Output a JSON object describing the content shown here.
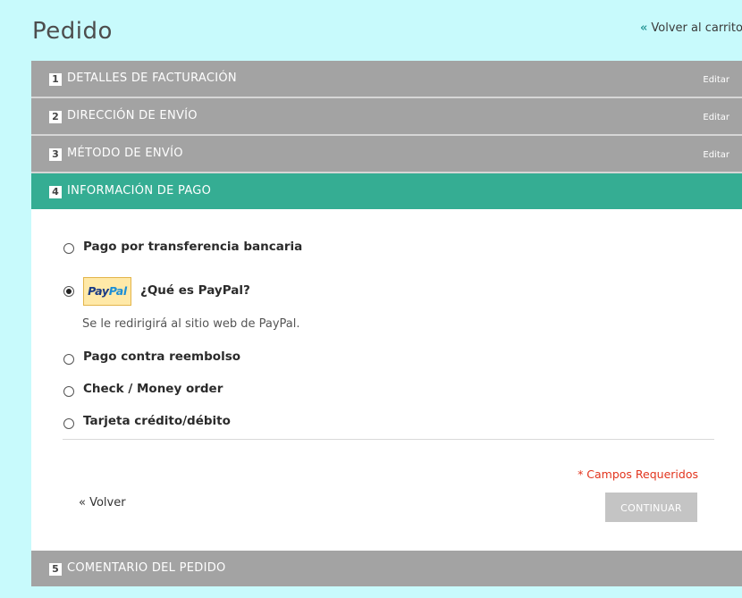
{
  "page": {
    "title": "Pedido",
    "back_to_cart": "Volver al carrito",
    "back_to_cart_prefix": "«"
  },
  "steps": [
    {
      "number": "1",
      "label": "DETALLES DE FACTURACIÓN",
      "edit": "Editar"
    },
    {
      "number": "2",
      "label": "DIRECCIÓN DE ENVÍO",
      "edit": "Editar"
    },
    {
      "number": "3",
      "label": "MÉTODO DE ENVÍO",
      "edit": "Editar"
    },
    {
      "number": "4",
      "label": "INFORMACIÓN DE PAGO"
    },
    {
      "number": "5",
      "label": "COMENTARIO DEL PEDIDO"
    }
  ],
  "payment": {
    "options": [
      {
        "label": "Pago por transferencia bancaria",
        "selected": false
      },
      {
        "label": "¿Qué es PayPal?",
        "selected": true,
        "logo_pay": "Pay",
        "logo_pal": "Pal",
        "note": "Se le redirigirá al sitio web de PayPal."
      },
      {
        "label": "Pago contra reembolso",
        "selected": false
      },
      {
        "label": "Check / Money order",
        "selected": false
      },
      {
        "label": "Tarjeta crédito/débito",
        "selected": false
      }
    ],
    "required_note": "* Campos Requeridos",
    "back_label": "« Volver",
    "continue_label": "CONTINUAR"
  },
  "colors": {
    "page_background": "#c8fafc",
    "step_inactive": "#a3a3a3",
    "step_active": "#35ad93",
    "required_text": "#e2341d",
    "continue_button": "#c4c4c4"
  }
}
